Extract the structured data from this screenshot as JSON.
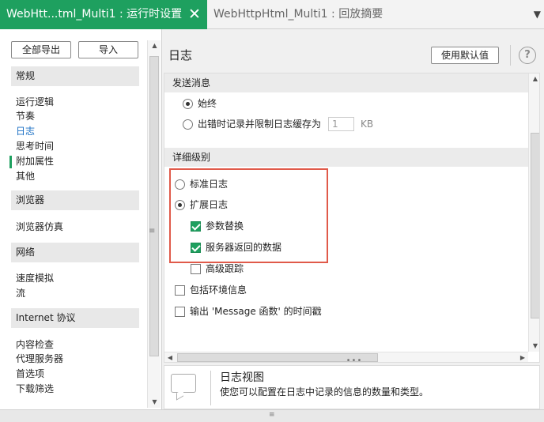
{
  "tabs": {
    "active": "WebHtt...tml_Multi1 : 运行时设置",
    "active_close": "✕",
    "inactive": "WebHttpHtml_Multi1 : 回放摘要",
    "menu": "▼"
  },
  "left": {
    "export_all": "全部导出",
    "import": "导入",
    "sections": [
      {
        "header": "常规",
        "items": [
          "运行逻辑",
          "节奏",
          "日志",
          "思考时间",
          "附加属性",
          "其他"
        ]
      },
      {
        "header": "浏览器",
        "items": [
          "浏览器仿真"
        ]
      },
      {
        "header": "网络",
        "items": [
          "速度模拟",
          "流"
        ]
      },
      {
        "header": "Internet 协议",
        "items": [
          "内容检查",
          "代理服务器",
          "首选项",
          "下载筛选"
        ]
      }
    ],
    "selected_item": "日志"
  },
  "right": {
    "title": "日志",
    "use_default": "使用默认值",
    "help": "?",
    "send_messages": {
      "header": "发送消息",
      "always": "始终",
      "on_error": "出错时记录并限制日志缓存为",
      "cache_size": "1",
      "cache_unit": "KB",
      "selected": "always"
    },
    "detail_level": {
      "header": "详细级别",
      "standard": "标准日志",
      "extended": "扩展日志",
      "param_substitution": "参数替换",
      "server_data": "服务器返回的数据",
      "advanced_trace": "高级跟踪",
      "include_env": "包括环境信息",
      "message_timestamp": "输出 'Message 函数' 的时间戳",
      "selected": "extended",
      "checked": {
        "param_substitution": true,
        "server_data": true,
        "advanced_trace": false,
        "include_env": false,
        "message_timestamp": false
      }
    }
  },
  "info": {
    "title": "日志视图",
    "description": "使您可以配置在日志中记录的信息的数量和类型。"
  },
  "colors": {
    "accent": "#1ea05f",
    "highlight_box": "#e05a4a",
    "selected_nav": "#1a6fc4"
  }
}
